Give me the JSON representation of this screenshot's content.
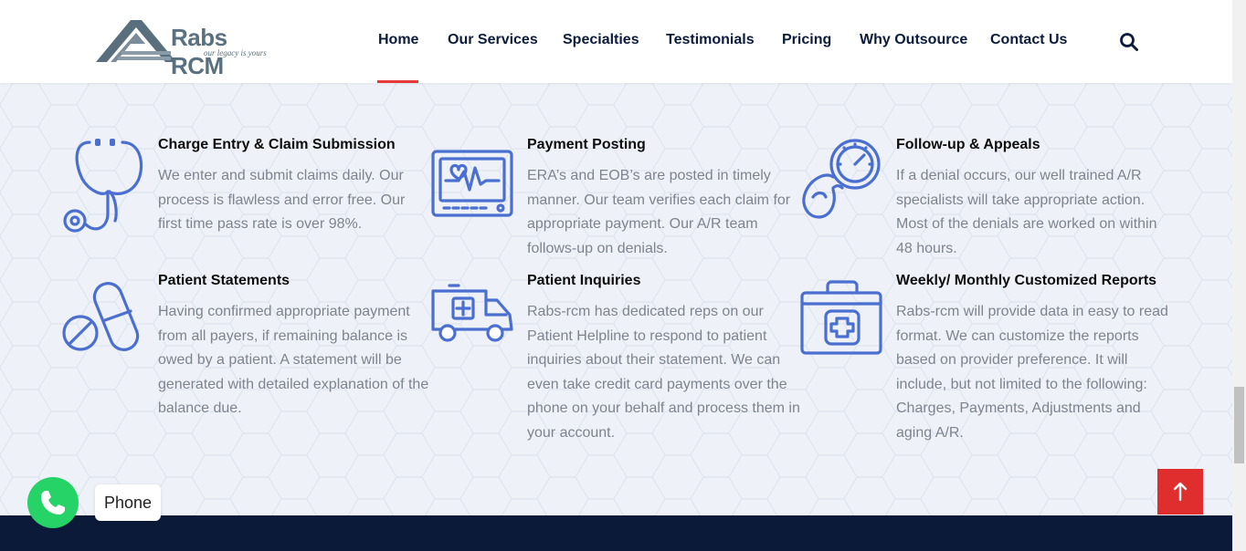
{
  "brand": {
    "name": "Rabs RCM",
    "tagline": "our legacy is yours"
  },
  "nav": {
    "items": [
      {
        "label": "Home",
        "active": true
      },
      {
        "label": "Our Services"
      },
      {
        "label": "Specialties"
      },
      {
        "label": "Testimonials"
      },
      {
        "label": "Pricing"
      },
      {
        "label": "Why Outsource"
      },
      {
        "label": "Contact Us"
      }
    ],
    "search_icon": "search-icon"
  },
  "colors": {
    "icon_blue": "#4a6fd1",
    "accent_red": "#e63a3a",
    "footer_navy": "#0a1a38",
    "whatsapp_green": "#25d366"
  },
  "features": [
    {
      "icon": "stethoscope-icon",
      "title": "Charge Entry & Claim Submission",
      "text": "We enter and submit claims daily. Our process is flawless and error free. Our first time pass rate is over 98%."
    },
    {
      "icon": "heart-monitor-icon",
      "title": "Payment Posting",
      "text": "ERA’s and EOB’s are posted in timely manner. Our team verifies each claim for appropriate payment. Our A/R team follows-up on denials."
    },
    {
      "icon": "blood-pressure-gauge-icon",
      "title": "Follow-up & Appeals",
      "text": "If a denial occurs, our well trained A/R specialists will take appropriate action. Most of the denials are worked on within 48 hours."
    },
    {
      "icon": "pills-icon",
      "title": "Patient Statements",
      "text": "Having confirmed appropriate payment from all payers, if remaining balance is owed by a patient. A statement will be generated with detailed explanation of the balance due."
    },
    {
      "icon": "ambulance-icon",
      "title": "Patient Inquiries",
      "text": "Rabs-rcm has dedicated reps on our Patient Helpline to respond to patient inquiries about their statement. We can even take credit card payments over the phone on your behalf and process them in your account."
    },
    {
      "icon": "first-aid-kit-icon",
      "title": "Weekly/ Monthly Customized Reports",
      "text": "Rabs-rcm will provide data in easy to read format. We can customize the reports based on provider preference. It will include, but not limited to the following: Charges, Payments, Adjustments and aging A/R."
    }
  ],
  "floating": {
    "phone_label": "Phone",
    "phone_icon": "phone-icon",
    "back_to_top_icon": "arrow-up-icon"
  }
}
